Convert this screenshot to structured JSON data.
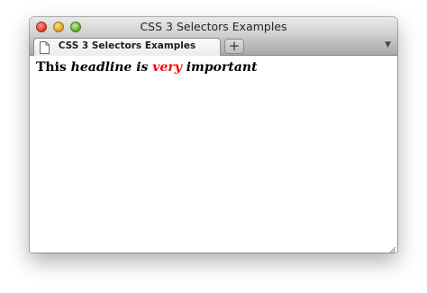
{
  "window": {
    "title": "CSS 3 Selectors Examples"
  },
  "tabs": [
    {
      "label": "CSS 3 Selectors Examples",
      "icon": "page-icon",
      "active": true
    }
  ],
  "toolbar": {
    "new_tab_label": "+",
    "overflow_icon": "chevron-down-icon"
  },
  "content": {
    "headline": {
      "part1": "This ",
      "part2": "headline is ",
      "part3": "very",
      "part4": " important"
    }
  },
  "colors": {
    "highlight": "#ff0000"
  }
}
